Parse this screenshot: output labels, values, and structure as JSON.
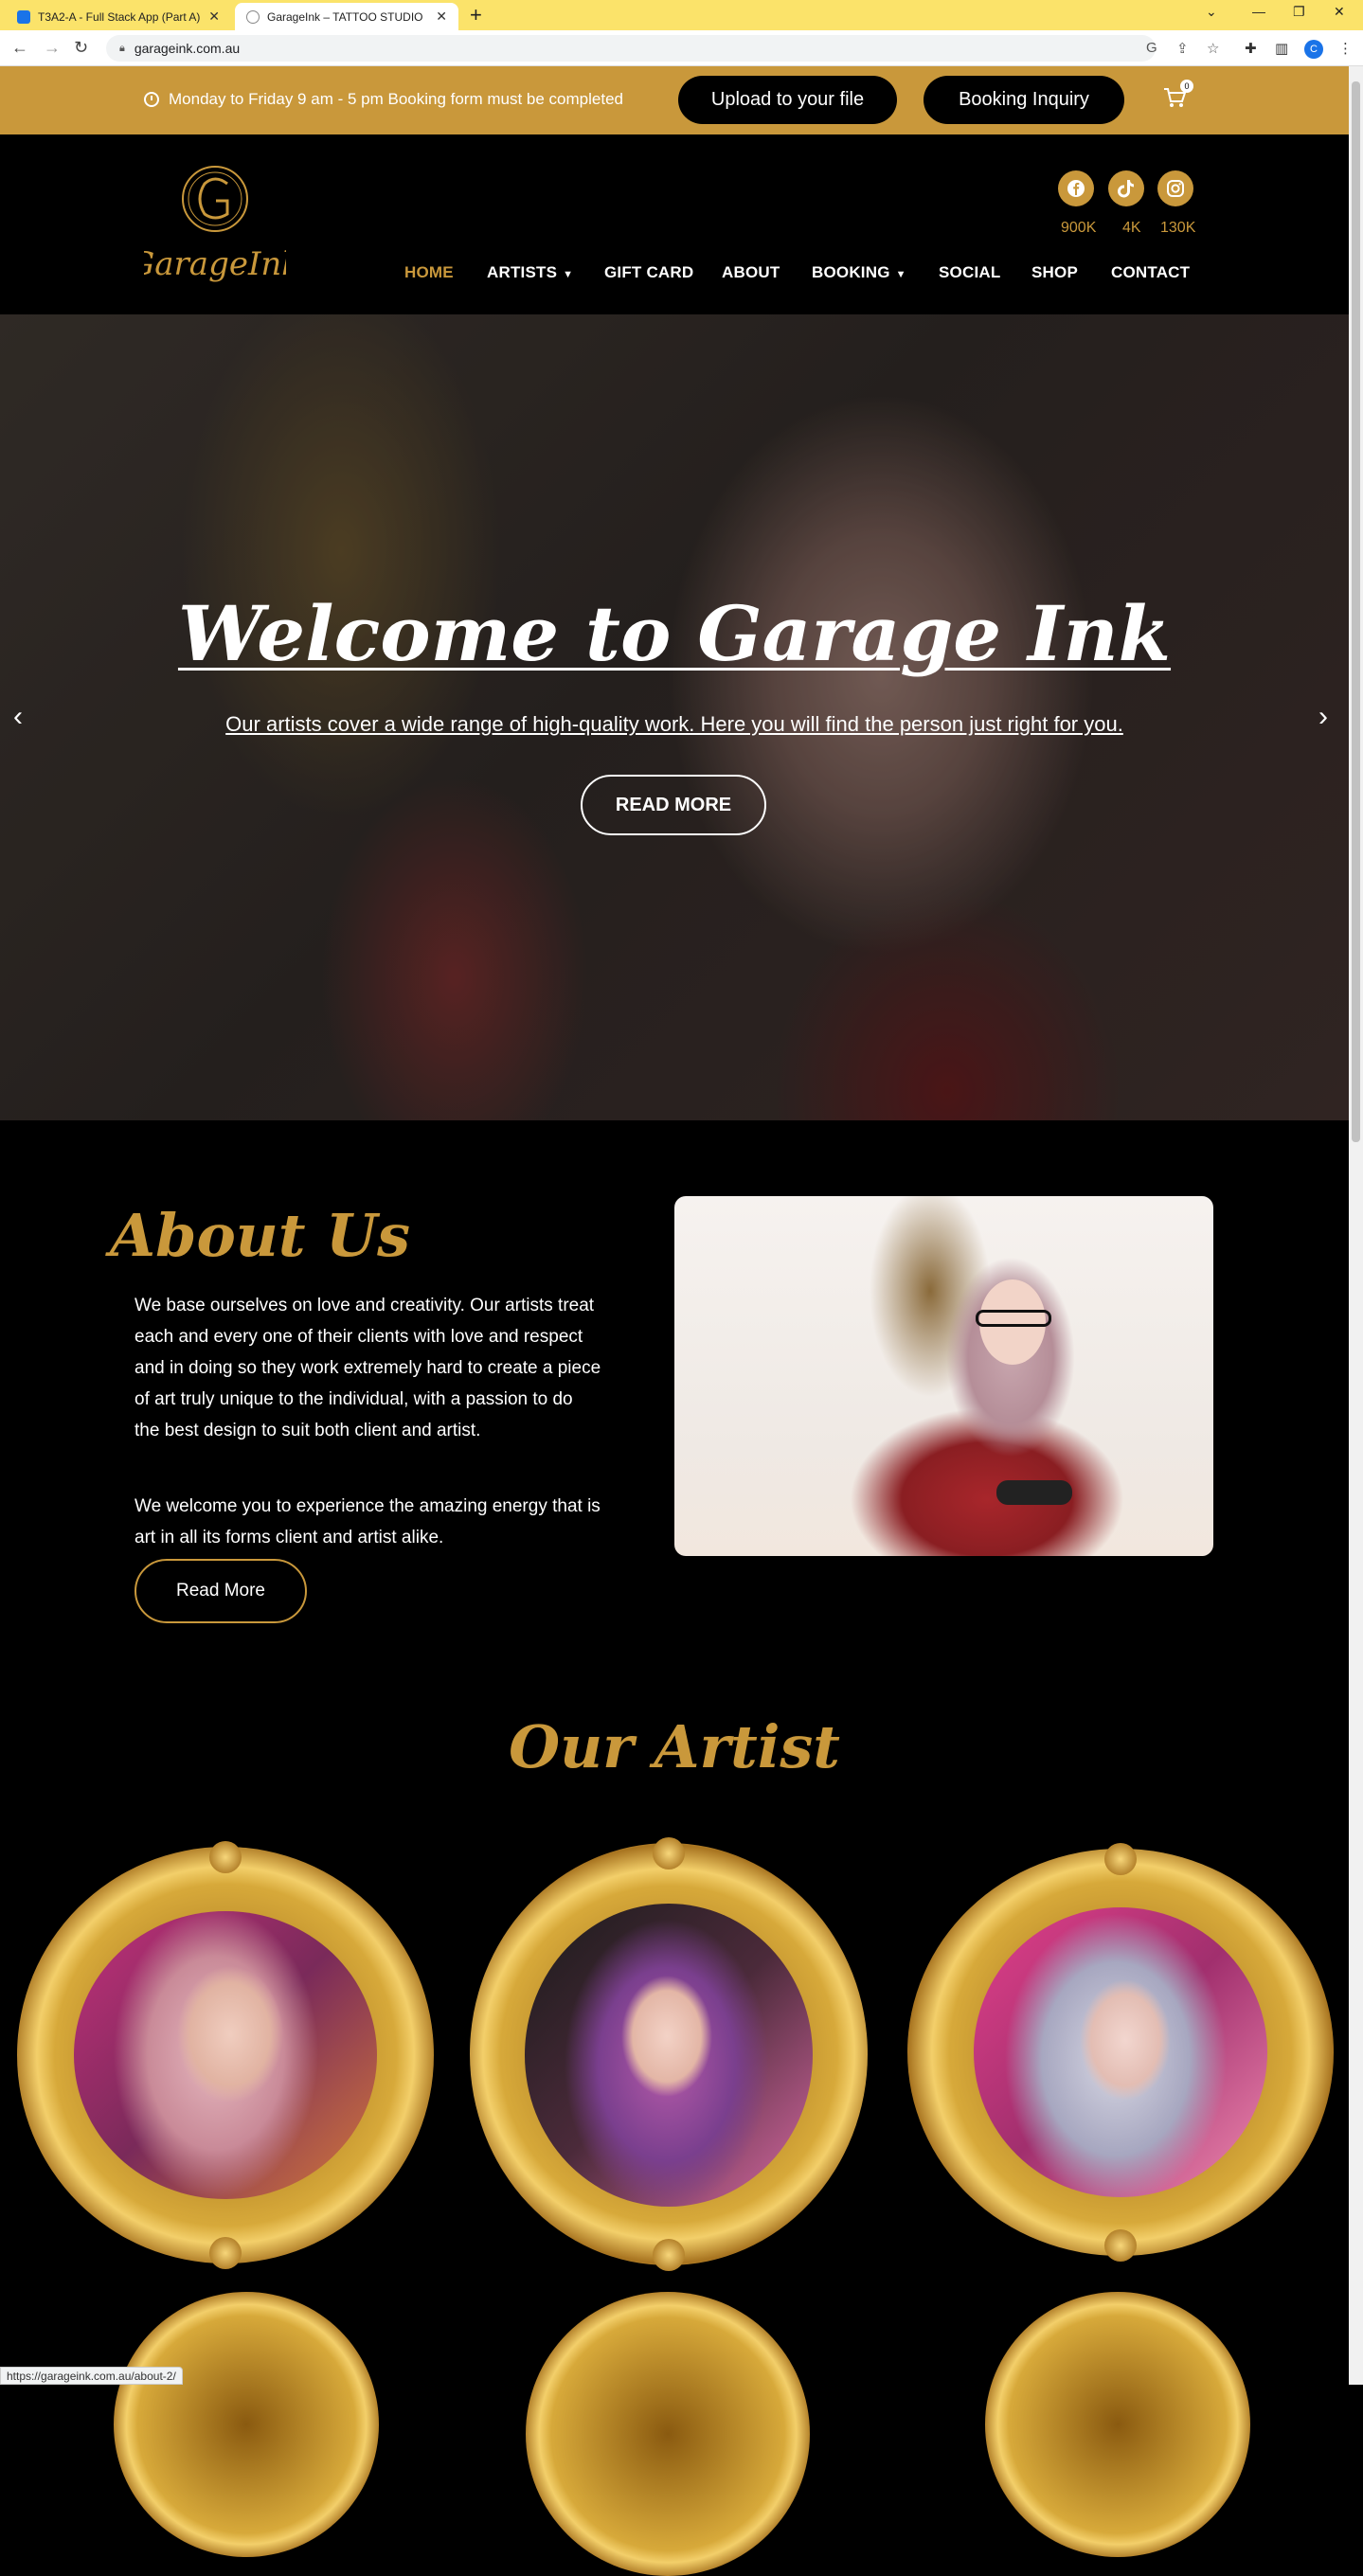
{
  "browser": {
    "tabs": [
      {
        "title": "T3A2-A - Full Stack App (Part A)",
        "active": false
      },
      {
        "title": "GarageInk – TATTOO STUDIO",
        "active": true
      }
    ],
    "url": "garageink.com.au",
    "profile_initial": "C",
    "status_url": "https://garageink.com.au/about-2/"
  },
  "topbar": {
    "hours": "Monday to Friday 9 am - 5 pm Booking form must be completed",
    "upload_label": "Upload to your file",
    "booking_label": "Booking Inquiry",
    "cart_count": "0"
  },
  "header": {
    "logo_text": "GarageInk",
    "socials": [
      {
        "icon": "facebook-icon",
        "count": "900K"
      },
      {
        "icon": "tiktok-icon",
        "count": "4K"
      },
      {
        "icon": "instagram-icon",
        "count": "130K"
      }
    ],
    "menu": [
      "HOME",
      "ARTISTS",
      "GIFT CARD",
      "ABOUT",
      "BOOKING",
      "SOCIAL",
      "SHOP",
      "CONTACT"
    ]
  },
  "hero": {
    "title": "Welcome to Garage Ink",
    "subtitle": "Our artists cover a wide range of high-quality work. Here you will find the person just right for you.",
    "button": "READ MORE"
  },
  "about": {
    "title": "About Us",
    "p1": "We base ourselves on love and creativity. Our artists treat each and every one of their clients with love and respect and in doing so they work extremely hard to create a piece of art truly unique to the individual, with a passion to do the best design to suit both client and artist.",
    "p2": "We welcome you to experience the amazing energy that is art in all its forms client and artist alike.",
    "button": "Read More"
  },
  "artists": {
    "title": "Our Artist"
  },
  "colors": {
    "gold": "#c9983b",
    "black": "#000000",
    "chrome_yellow": "#fbe36a"
  }
}
